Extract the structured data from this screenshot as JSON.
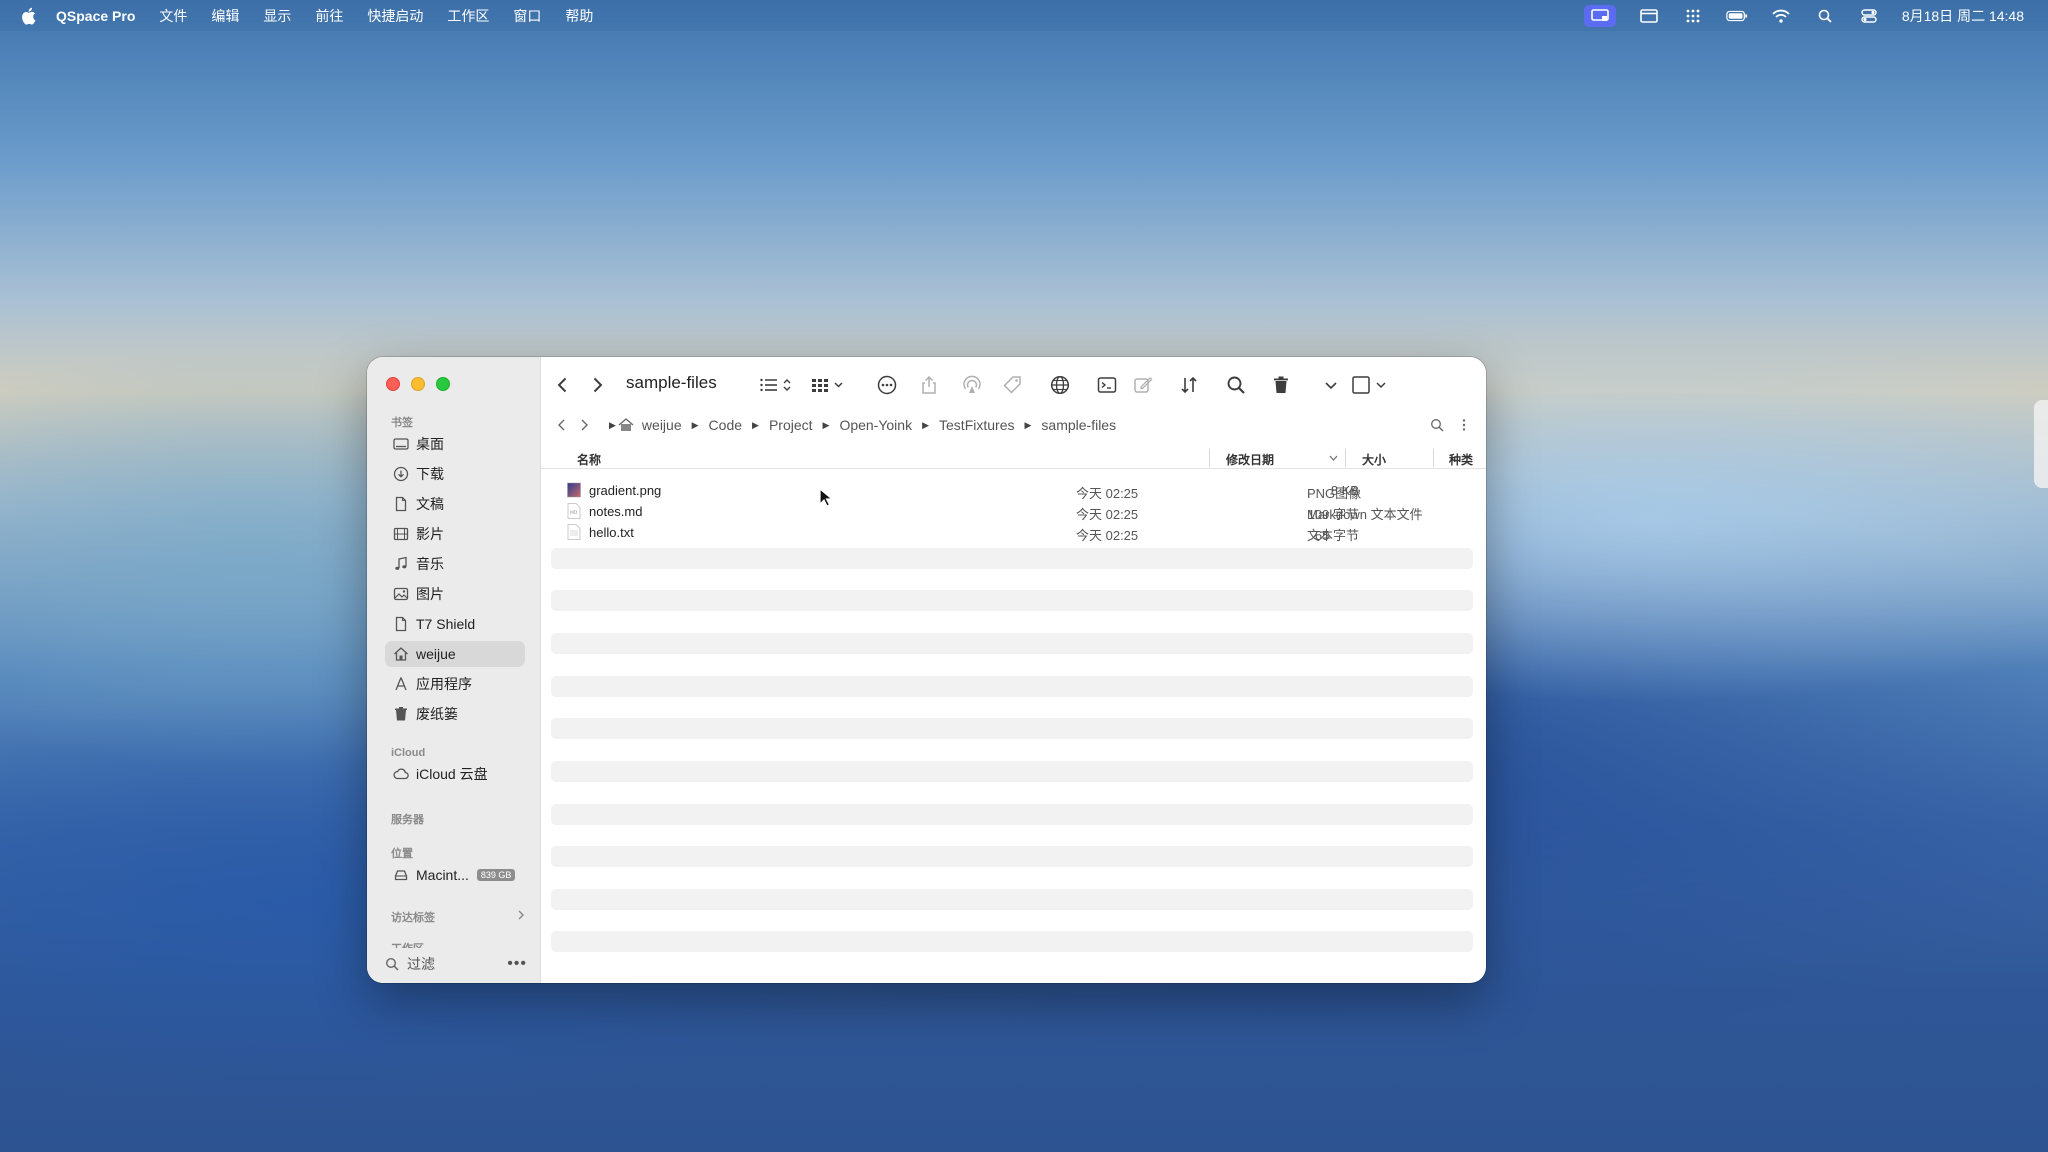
{
  "menubar": {
    "app_name": "QSpace Pro",
    "menus": [
      "文件",
      "编辑",
      "显示",
      "前往",
      "快捷启动",
      "工作区",
      "窗口",
      "帮助"
    ],
    "clock": "8月18日 周二 14:48"
  },
  "window": {
    "title": "sample-files",
    "path": [
      "weijue",
      "Code",
      "Project",
      "Open-Yoink",
      "TestFixtures",
      "sample-files"
    ]
  },
  "sidebar": {
    "section_bookmarks": "书签",
    "items": [
      {
        "label": "桌面",
        "icon": "desktop-icon"
      },
      {
        "label": "下载",
        "icon": "download-icon"
      },
      {
        "label": "文稿",
        "icon": "document-icon"
      },
      {
        "label": "影片",
        "icon": "film-icon"
      },
      {
        "label": "音乐",
        "icon": "music-icon"
      },
      {
        "label": "图片",
        "icon": "photo-icon"
      },
      {
        "label": "T7 Shield",
        "icon": "document-icon"
      },
      {
        "label": "weijue",
        "icon": "home-icon"
      },
      {
        "label": "应用程序",
        "icon": "apps-icon"
      },
      {
        "label": "废纸篓",
        "icon": "trash-icon"
      }
    ],
    "section_icloud": "iCloud",
    "icloud_drive": "iCloud 云盘",
    "section_servers": "服务器",
    "section_locations": "位置",
    "disk_name": "Macint...",
    "disk_badge": "839 GB",
    "section_tags": "访达标签",
    "section_cut": "工作区",
    "filter_placeholder": "过滤"
  },
  "table": {
    "headers": {
      "name": "名称",
      "modified": "修改日期",
      "size": "大小",
      "kind": "种类"
    },
    "rows": [
      {
        "name": "gradient.png",
        "modified": "今天 02:25",
        "size": "8 KB",
        "kind": "PNG图像",
        "icon": "png-file-icon"
      },
      {
        "name": "notes.md",
        "modified": "今天 02:25",
        "size": "109 字节",
        "kind": "Markdown 文本文件",
        "icon": "markdown-file-icon"
      },
      {
        "name": "hello.txt",
        "modified": "今天 02:25",
        "size": "65 字节",
        "kind": "文本",
        "icon": "text-file-icon"
      }
    ]
  },
  "colors": {
    "accent": "#5b6cf0",
    "close": "#ff5f57",
    "minimize": "#febc2e",
    "maximize": "#28c840"
  }
}
